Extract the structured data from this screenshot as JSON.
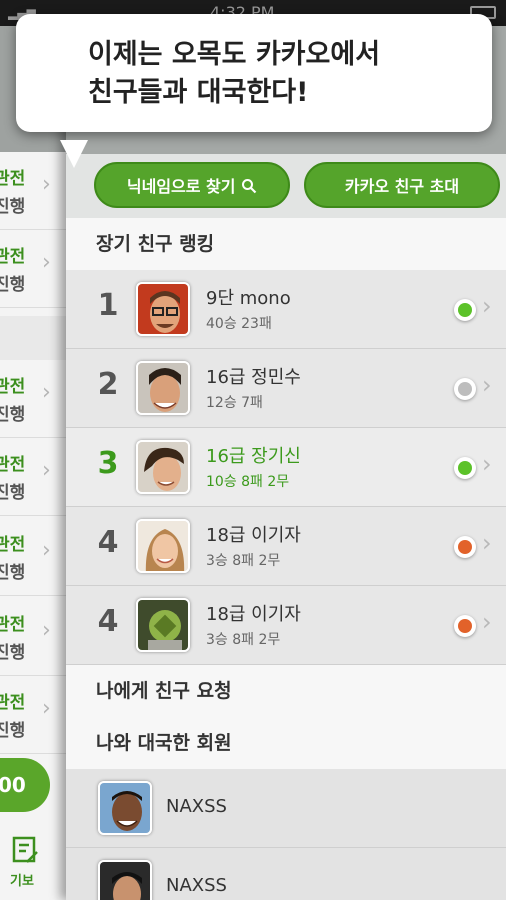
{
  "status_bar": {
    "time": "4:32 PM"
  },
  "tooltip": {
    "line1": "이제는 오목도 카카오에서",
    "line2": "친구들과 대국한다!"
  },
  "left_panel": {
    "rows": [
      {
        "top": "관전",
        "bottom": "진행"
      },
      {
        "top": "관전",
        "bottom": "진행"
      },
      {
        "top": "관전",
        "bottom": "진행"
      },
      {
        "top": "관전",
        "bottom": "진행"
      },
      {
        "top": "관전",
        "bottom": "진행"
      },
      {
        "top": "관전",
        "bottom": "진행"
      },
      {
        "top": "관전",
        "bottom": "진행"
      }
    ],
    "pill_text": "00",
    "tab_label": "기보"
  },
  "buttons": {
    "find_nickname": "닉네임으로 찾기",
    "invite_kakao": "카카오 친구 초대"
  },
  "sections": {
    "ranking_title": "장기 친구 랭킹",
    "requests_title": "나에게 친구 요청",
    "played_title": "나와 대국한 회원"
  },
  "ranking": [
    {
      "rank": "1",
      "name": "9단 mono",
      "record": "40승 23패",
      "status": "online"
    },
    {
      "rank": "2",
      "name": "16급 정민수",
      "record": "12승 7패",
      "status": "offline"
    },
    {
      "rank": "3",
      "name": "16급 장기신",
      "record": "10승 8패 2무",
      "status": "online"
    },
    {
      "rank": "4",
      "name": "18급 이기자",
      "record": "3승 8패 2무",
      "status": "busy"
    },
    {
      "rank": "4",
      "name": "18급 이기자",
      "record": "3승 8패 2무",
      "status": "busy"
    }
  ],
  "played_members": [
    {
      "name": "NAXSS"
    },
    {
      "name": "NAXSS"
    }
  ],
  "colors": {
    "accent_green": "#55a42b",
    "online": "#5cc229",
    "offline": "#bdbdbd",
    "busy": "#e2622a"
  }
}
